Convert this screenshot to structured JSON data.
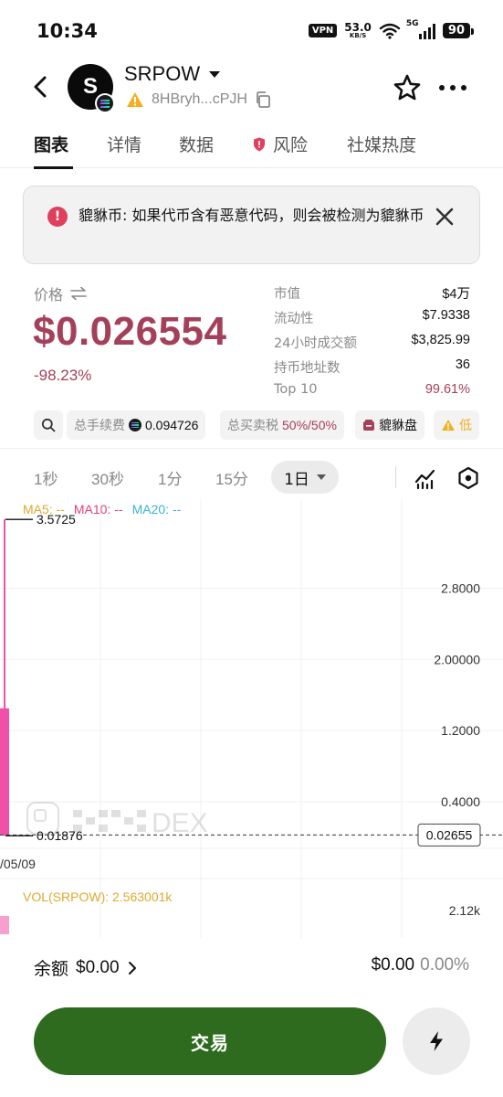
{
  "status_bar": {
    "time": "10:34",
    "vpn": "VPN",
    "net_speed_value": "53.0",
    "net_speed_unit": "KB/S",
    "network": "5G",
    "battery": "90"
  },
  "header": {
    "token_logo_letter": "S",
    "token_name": "SRPOW",
    "address": "8HBryh...cPJH"
  },
  "tabs": [
    {
      "label": "图表"
    },
    {
      "label": "详情"
    },
    {
      "label": "数据"
    },
    {
      "label": "风险"
    },
    {
      "label": "社媒热度"
    }
  ],
  "alert": {
    "icon": "!",
    "text": "貔貅币: 如果代币含有恶意代码，则会被检测为貔貅币"
  },
  "price": {
    "label": "价格",
    "value": "$0.026554",
    "change": "-98.23%"
  },
  "stats": [
    {
      "label": "市值",
      "value": "$4万"
    },
    {
      "label": "流动性",
      "value": "$7.9338"
    },
    {
      "label": "24小时成交额",
      "value": "$3,825.99"
    },
    {
      "label": "持币地址数",
      "value": "36"
    },
    {
      "label": "Top 10",
      "value": "99.61%"
    }
  ],
  "chips": {
    "fee_label": "总手续费",
    "fee_value": "0.094726",
    "tax_label": "总买卖税",
    "tax_value": "50%/50%",
    "honeypot_label": "貔貅盘",
    "partial_label": "低"
  },
  "timeframes": {
    "options": [
      "1秒",
      "30秒",
      "1分",
      "15分"
    ],
    "selected": "1日"
  },
  "chart_data": {
    "type": "candlestick",
    "ma_legend": [
      "MA5: --",
      "MA10: --",
      "MA20: --"
    ],
    "y_ticks": [
      "2.8000",
      "2.00000",
      "1.2000",
      "0.4000"
    ],
    "y_tick_values": [
      2.8,
      2.0,
      1.2,
      0.4
    ],
    "ylim": [
      0.0,
      3.8
    ],
    "high_label": "3.5725",
    "low_label": "0.01876",
    "current_price_label": "0.02655",
    "x_label": "/05/09",
    "candle": {
      "open": 1.45,
      "high": 3.5725,
      "low": 0.01876,
      "close": 0.02655
    },
    "watermark": "DEX",
    "volume_label": "VOL(SRPOW): 2.563001k",
    "volume_tick": "2.12k",
    "colors": {
      "up": "#1fa04b",
      "down": "#f050a8",
      "ma5": "#e0a92e",
      "ma10": "#e0407a",
      "ma20": "#38b4d4"
    }
  },
  "balance": {
    "label": "余额",
    "amount": "$0.00",
    "usd": "$0.00",
    "pct": "0.00%"
  },
  "trade": {
    "label": "交易"
  },
  "colors": {
    "accent_red": "#a4405a",
    "trade_green": "#2e6b1e"
  }
}
